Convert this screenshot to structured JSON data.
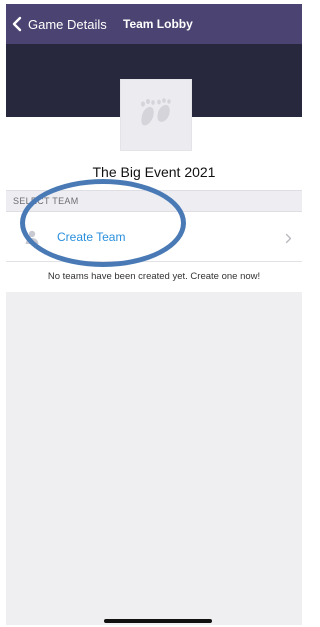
{
  "navbar": {
    "back_label": "Game Details",
    "title": "Team Lobby"
  },
  "event": {
    "title": "The Big Event 2021"
  },
  "section": {
    "label": "SELECT TEAM"
  },
  "create_team": {
    "label": "Create Team"
  },
  "empty_message": "No teams have been created yet. Create one now!",
  "icons": {
    "back": "chevron-left-icon",
    "logo": "footprints-icon",
    "row": "person-icon",
    "forward": "chevron-right-icon"
  },
  "colors": {
    "navbar": "#4b4472",
    "header_band": "#27283d",
    "link": "#2a8fdc",
    "annotation": "#4a7ab5"
  }
}
